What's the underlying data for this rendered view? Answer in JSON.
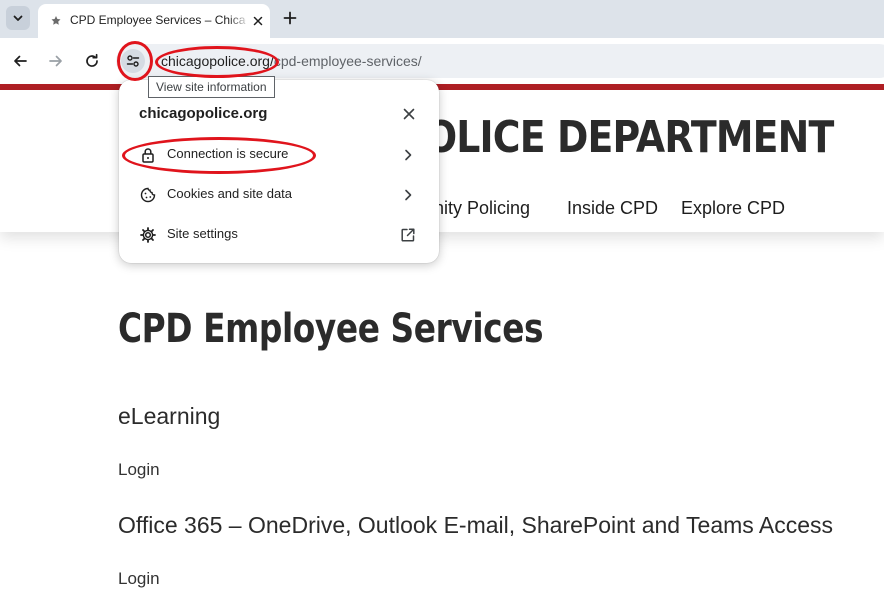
{
  "browser": {
    "tab": {
      "title": "CPD Employee Services – Chicago Police Department"
    },
    "url_host": "chicagopolice.org/",
    "url_path": "cpd-employee-services/",
    "tooltip": "View site information"
  },
  "site_info_popup": {
    "domain": "chicagopolice.org",
    "items": [
      {
        "label": "Connection is secure",
        "icon": "lock-icon",
        "trailing": "chevron-right-icon"
      },
      {
        "label": "Cookies and site data",
        "icon": "cookie-icon",
        "trailing": "chevron-right-icon"
      },
      {
        "label": "Site settings",
        "icon": "gear-icon",
        "trailing": "open-external-icon"
      }
    ]
  },
  "site": {
    "title": "OLICE DEPARTMENT",
    "nav": [
      "unity Policing",
      "Inside CPD",
      "Explore CPD"
    ]
  },
  "content": {
    "page_title": "CPD Employee Services",
    "sections": [
      {
        "heading": "eLearning",
        "link": "Login"
      },
      {
        "heading": "Office 365 – OneDrive, Outlook E-mail, SharePoint and Teams Access",
        "link": "Login"
      }
    ]
  },
  "colors": {
    "brand_red": "#b01f24",
    "annotation_red": "#e0141c",
    "tabstrip": "#dde3ea"
  }
}
